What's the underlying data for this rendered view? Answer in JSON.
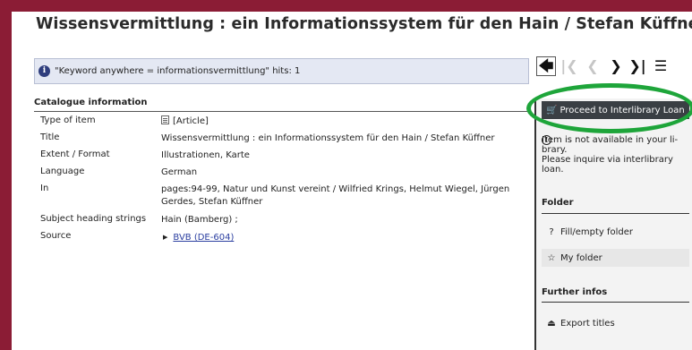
{
  "page_title": "Wissensvermittlung : ein Informationssystem für den Hain / Stefan Küffner",
  "search_result": {
    "info_icon": "i",
    "text": "\"Keyword anywhere = informationsvermittlung\" hits: 1"
  },
  "nav": {
    "back_icon": "🡄",
    "first_icon": "|❮",
    "prev_icon": "❮",
    "next_icon": "❯",
    "last_icon": "❯|",
    "list_icon": "☰"
  },
  "catalogue": {
    "heading": "Catalogue information",
    "rows": [
      {
        "label": "Type of item",
        "value": "[Article]"
      },
      {
        "label": "Title",
        "value": "Wissensvermittlung : ein Informationssystem für den Hain / Stefan Küffner"
      },
      {
        "label": "Extent / Format",
        "value": "Illustrationen, Karte"
      },
      {
        "label": "Language",
        "value": "German"
      },
      {
        "label": "In",
        "value": "pages:94-99, Natur und Kunst vereint / Wilfried Krings, Helmut Wiegel, Jürgen Gerdes, Stefan Küffner"
      },
      {
        "label": "Subject heading strings",
        "value": "Hain (Bamberg) ;"
      },
      {
        "label": "Source",
        "value": "BVB (DE-604)"
      }
    ]
  },
  "sidebar": {
    "ill_button": "Proceed to Interlibrary Loan",
    "ill_icon": "🛒",
    "notice_icon": "!",
    "notice_lines": [
      "Item is not available in your li-",
      "brary.",
      "Please inquire via interlibrary",
      "loan."
    ],
    "folder_heading": "Folder",
    "fill_folder": "Fill/empty folder",
    "fill_folder_icon": "?",
    "my_folder": "My folder",
    "my_folder_icon": "☆",
    "further_heading": "Further infos",
    "export_titles": "Export titles",
    "export_icon": "⏏"
  },
  "colors": {
    "frame": "#8b1c35",
    "highlight_ring": "#1ea53a",
    "ill_button_bg": "#3a3f44",
    "info_box_bg": "#e4e8f3"
  }
}
